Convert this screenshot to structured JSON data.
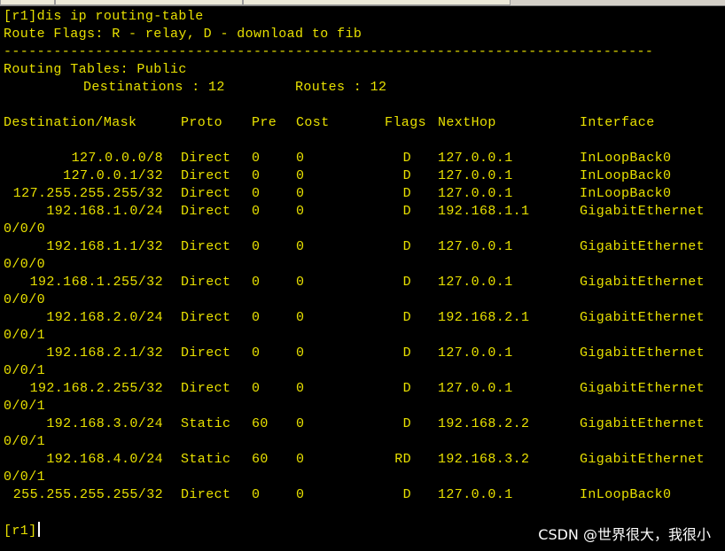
{
  "colors": {
    "background": "#000000",
    "text": "#e8e000",
    "watermark": "#ffffff",
    "cursor": "#ffffff"
  },
  "console": {
    "command_line": "[r1]dis ip routing-table",
    "flags_legend": "Route Flags: R - relay, D - download to fib",
    "separator": "------------------------------------------------------------------------------",
    "tables_title": "Routing Tables: Public",
    "destinations_label": "Destinations : 12",
    "routes_label": "Routes : 12",
    "columns": {
      "destination": "Destination/Mask",
      "proto": "Proto",
      "pre": "Pre",
      "cost": "Cost",
      "flags": "Flags",
      "nexthop": "NextHop",
      "interface": "Interface"
    },
    "routes": [
      {
        "dest": "127.0.0.0/8",
        "proto": "Direct",
        "pre": "0",
        "cost": "0",
        "flags": "D",
        "nexthop": "127.0.0.1",
        "interface": "InLoopBack0",
        "cont": ""
      },
      {
        "dest": "127.0.0.1/32",
        "proto": "Direct",
        "pre": "0",
        "cost": "0",
        "flags": "D",
        "nexthop": "127.0.0.1",
        "interface": "InLoopBack0",
        "cont": ""
      },
      {
        "dest": "127.255.255.255/32",
        "proto": "Direct",
        "pre": "0",
        "cost": "0",
        "flags": "D",
        "nexthop": "127.0.0.1",
        "interface": "InLoopBack0",
        "cont": ""
      },
      {
        "dest": "192.168.1.0/24",
        "proto": "Direct",
        "pre": "0",
        "cost": "0",
        "flags": "D",
        "nexthop": "192.168.1.1",
        "interface": "GigabitEthernet",
        "cont": "0/0/0"
      },
      {
        "dest": "192.168.1.1/32",
        "proto": "Direct",
        "pre": "0",
        "cost": "0",
        "flags": "D",
        "nexthop": "127.0.0.1",
        "interface": "GigabitEthernet",
        "cont": "0/0/0"
      },
      {
        "dest": "192.168.1.255/32",
        "proto": "Direct",
        "pre": "0",
        "cost": "0",
        "flags": "D",
        "nexthop": "127.0.0.1",
        "interface": "GigabitEthernet",
        "cont": "0/0/0"
      },
      {
        "dest": "192.168.2.0/24",
        "proto": "Direct",
        "pre": "0",
        "cost": "0",
        "flags": "D",
        "nexthop": "192.168.2.1",
        "interface": "GigabitEthernet",
        "cont": "0/0/1"
      },
      {
        "dest": "192.168.2.1/32",
        "proto": "Direct",
        "pre": "0",
        "cost": "0",
        "flags": "D",
        "nexthop": "127.0.0.1",
        "interface": "GigabitEthernet",
        "cont": "0/0/1"
      },
      {
        "dest": "192.168.2.255/32",
        "proto": "Direct",
        "pre": "0",
        "cost": "0",
        "flags": "D",
        "nexthop": "127.0.0.1",
        "interface": "GigabitEthernet",
        "cont": "0/0/1"
      },
      {
        "dest": "192.168.3.0/24",
        "proto": "Static",
        "pre": "60",
        "cost": "0",
        "flags": "D",
        "nexthop": "192.168.2.2",
        "interface": "GigabitEthernet",
        "cont": "0/0/1"
      },
      {
        "dest": "192.168.4.0/24",
        "proto": "Static",
        "pre": "60",
        "cost": "0",
        "flags": "RD",
        "nexthop": "192.168.3.2",
        "interface": "GigabitEthernet",
        "cont": "0/0/1"
      },
      {
        "dest": "255.255.255.255/32",
        "proto": "Direct",
        "pre": "0",
        "cost": "0",
        "flags": "D",
        "nexthop": "127.0.0.1",
        "interface": "InLoopBack0",
        "cont": ""
      }
    ],
    "prompt": "[r1]"
  },
  "watermark": "CSDN @世界很大，我很小"
}
